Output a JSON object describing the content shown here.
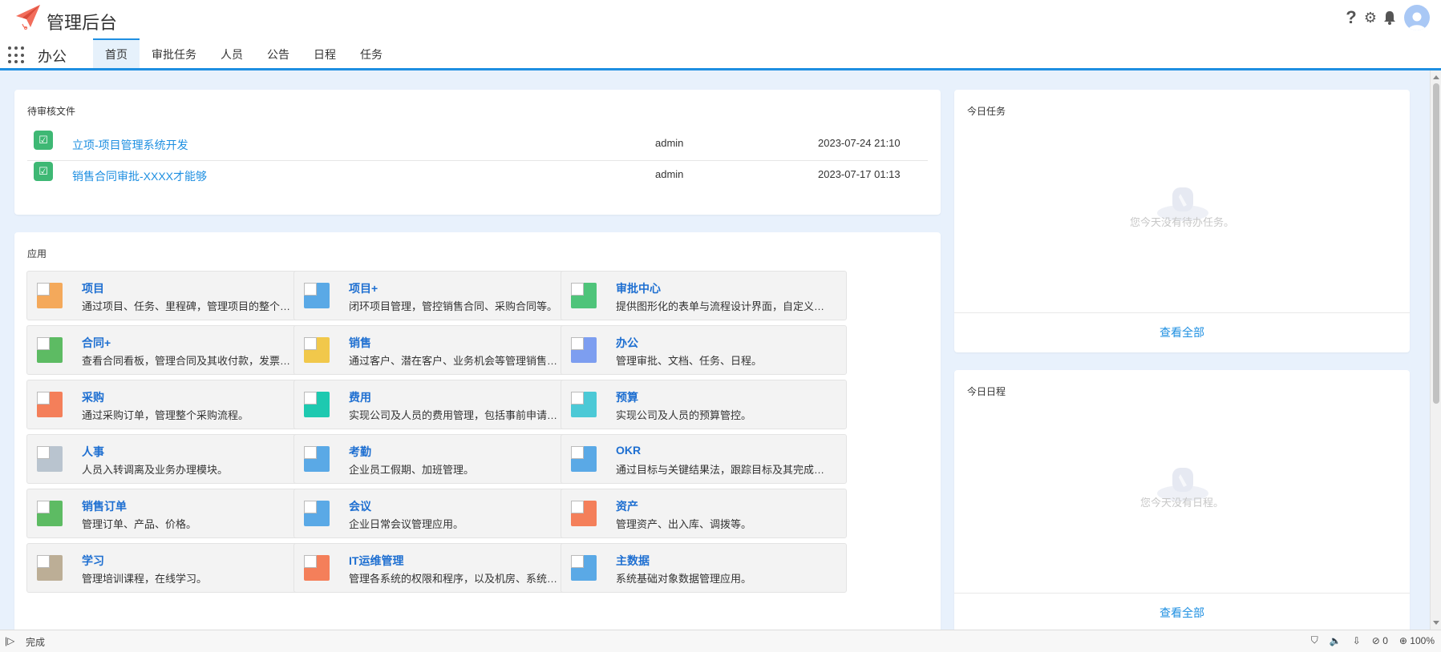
{
  "header": {
    "app_title": "管理后台",
    "module_name": "办公",
    "help_glyph": "?",
    "settings_glyph": "⚙",
    "bell_glyph": "🔔"
  },
  "tabs": [
    {
      "label": "首页",
      "active": true
    },
    {
      "label": "审批任务",
      "active": false
    },
    {
      "label": "人员",
      "active": false
    },
    {
      "label": "公告",
      "active": false
    },
    {
      "label": "日程",
      "active": false
    },
    {
      "label": "任务",
      "active": false
    }
  ],
  "pending": {
    "title": "待审核文件",
    "rows": [
      {
        "icon": "checklist-icon",
        "title": "立项-项目管理系统开发",
        "user": "admin",
        "date": "2023-07-24 21:10"
      },
      {
        "icon": "checklist-icon",
        "title": "销售合同审批-XXXX才能够",
        "user": "admin",
        "date": "2023-07-17 01:13"
      }
    ]
  },
  "apps": {
    "title": "应用",
    "items": [
      {
        "name": "项目",
        "desc": "通过项目、任务、里程碑，管理项目的整个生命周期。",
        "color": "#f4a95b"
      },
      {
        "name": "项目+",
        "desc": "闭环项目管理，管控销售合同、采购合同等。",
        "color": "#5aa9e6"
      },
      {
        "name": "审批中心",
        "desc": "提供图形化的表单与流程设计界面，自定义审批。",
        "color": "#4fc47a"
      },
      {
        "name": "合同+",
        "desc": "查看合同看板，管理合同及其收付款，发票等。",
        "color": "#5dbb63"
      },
      {
        "name": "销售",
        "desc": "通过客户、潜在客户、业务机会等管理销售过程。",
        "color": "#f1c84b"
      },
      {
        "name": "办公",
        "desc": "管理审批、文档、任务、日程。",
        "color": "#7d9ef0"
      },
      {
        "name": "采购",
        "desc": "通过采购订单，管理整个采购流程。",
        "color": "#f47f5a"
      },
      {
        "name": "费用",
        "desc": "实现公司及人员的费用管理，包括事前申请与报销。",
        "color": "#1ec9b0"
      },
      {
        "name": "预算",
        "desc": "实现公司及人员的预算管控。",
        "color": "#4cc9d6"
      },
      {
        "name": "人事",
        "desc": "人员入转调离及业务办理模块。",
        "color": "#b9c4cf"
      },
      {
        "name": "考勤",
        "desc": "企业员工假期、加班管理。",
        "color": "#5aa9e6"
      },
      {
        "name": "OKR",
        "desc": "通过目标与关键结果法，跟踪目标及其完成情况。",
        "color": "#5aa9e6"
      },
      {
        "name": "销售订单",
        "desc": "管理订单、产品、价格。",
        "color": "#5dbb63"
      },
      {
        "name": "会议",
        "desc": "企业日常会议管理应用。",
        "color": "#5aa9e6"
      },
      {
        "name": "资产",
        "desc": "管理资产、出入库、调拨等。",
        "color": "#f47f5a"
      },
      {
        "name": "学习",
        "desc": "管理培训课程，在线学习。",
        "color": "#bcae96"
      },
      {
        "name": "IT运维管理",
        "desc": "管理各系统的权限和程序，以及机房、系统设备。",
        "color": "#f47f5a"
      },
      {
        "name": "主数据",
        "desc": "系统基础对象数据管理应用。",
        "color": "#5aa9e6"
      }
    ]
  },
  "tasks": {
    "title": "今日任务",
    "empty_text": "您今天没有待办任务。",
    "see_all": "查看全部"
  },
  "schedule": {
    "title": "今日日程",
    "empty_text": "您今天没有日程。",
    "see_all": "查看全部"
  },
  "statusbar": {
    "status": "完成",
    "count": "0",
    "zoom": "100%"
  }
}
